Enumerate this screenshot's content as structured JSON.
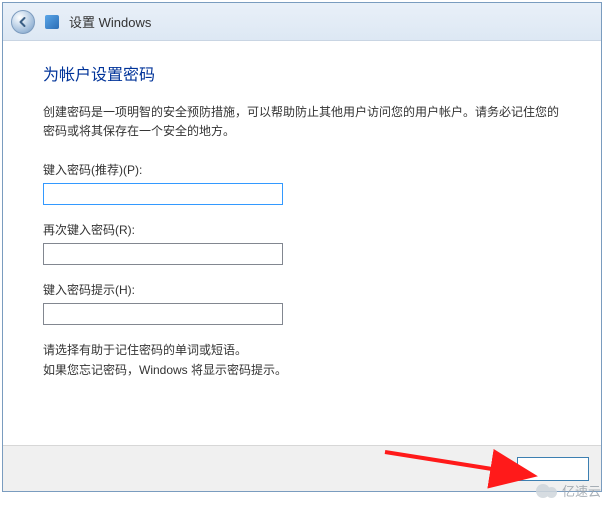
{
  "titlebar": {
    "title": "设置 Windows"
  },
  "page": {
    "heading": "为帐户设置密码",
    "description": "创建密码是一项明智的安全预防措施，可以帮助防止其他用户访问您的用户帐户。请务必记住您的密码或将其保存在一个安全的地方。",
    "fields": {
      "password": {
        "label": "键入密码(推荐)(P):",
        "value": ""
      },
      "confirm": {
        "label": "再次键入密码(R):",
        "value": ""
      },
      "hint": {
        "label": "键入密码提示(H):",
        "value": ""
      }
    },
    "hint_text_1": "请选择有助于记住密码的单词或短语。",
    "hint_text_2": "如果您忘记密码，Windows 将显示密码提示。"
  },
  "footer": {
    "next_label": ""
  },
  "watermark": {
    "text": "亿速云"
  }
}
